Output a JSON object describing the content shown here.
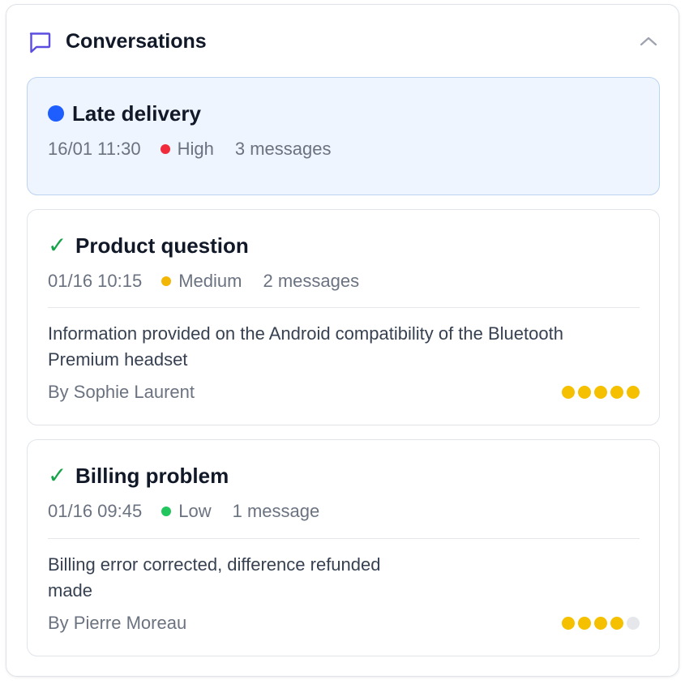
{
  "header": {
    "title": "Conversations",
    "icon": "chat-bubble-icon",
    "collapse_icon": "chevron-up-icon"
  },
  "colors": {
    "accent": "#1e5eff",
    "high": "#ef2b3c",
    "medium": "#f2b705",
    "low": "#22c55e",
    "resolved": "#16a34a",
    "star_on": "#f5c000",
    "star_off": "#e5e7eb"
  },
  "conversations": [
    {
      "title": "Late delivery",
      "status_icon": "blue-dot-icon",
      "date": "16/01 11:30",
      "priority": "High",
      "messages": "3 messages"
    },
    {
      "title": "Product question",
      "status_icon": "checkmark-icon",
      "date": "01/16 10:15",
      "priority": "Medium",
      "messages": "2 messages",
      "summary": "Information provided on the Android compatibility of the Bluetooth Premium headset",
      "author": "By Sophie Laurent",
      "rating": 5,
      "rating_max": 5
    },
    {
      "title": "Billing problem",
      "status_icon": "checkmark-icon",
      "date": "01/16 09:45",
      "priority": "Low",
      "messages": "1 message",
      "summary": "Billing error corrected, difference refunded\n made",
      "author": "By Pierre Moreau",
      "rating": 4,
      "rating_max": 5
    }
  ]
}
